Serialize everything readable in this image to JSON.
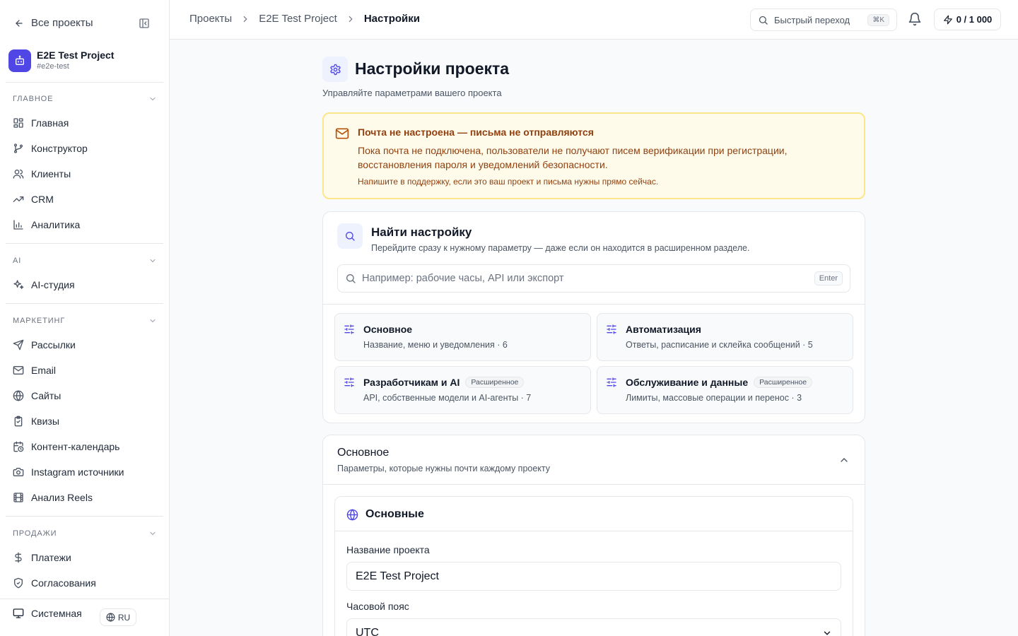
{
  "sidebar": {
    "back_label": "Все проекты",
    "project": {
      "name": "E2E Test Project",
      "slug": "#e2e-test"
    },
    "sections": [
      {
        "title": "ГЛАВНОЕ",
        "items": [
          "Главная",
          "Конструктор",
          "Клиенты",
          "CRM",
          "Аналитика"
        ]
      },
      {
        "title": "AI",
        "items": [
          "AI-студия"
        ]
      },
      {
        "title": "МАРКЕТИНГ",
        "items": [
          "Рассылки",
          "Email",
          "Сайты",
          "Квизы",
          "Контент-календарь",
          "Instagram источники",
          "Анализ Reels"
        ]
      },
      {
        "title": "ПРОДАЖИ",
        "items": [
          "Платежи",
          "Согласования"
        ]
      }
    ],
    "theme_label": "Системная",
    "language": "RU"
  },
  "topbar": {
    "breadcrumb": [
      "Проекты",
      "E2E Test Project",
      "Настройки"
    ],
    "quick_nav_label": "Быстрый переход",
    "quick_nav_shortcut": "⌘K",
    "credits": "0 / 1 000"
  },
  "page": {
    "title": "Настройки проекта",
    "subtitle": "Управляйте параметрами вашего проекта"
  },
  "alert": {
    "title": "Почта не настроена — письма не отправляются",
    "body": "Пока почта не подключена, пользователи не получают писем верификации при регистрации, восстановления пароля и уведомлений безопасности.",
    "note": "Напишите в поддержку, если это ваш проект и письма нужны прямо сейчас."
  },
  "find": {
    "title": "Найти настройку",
    "subtitle": "Перейдите сразу к нужному параметру — даже если он находится в расширенном разделе.",
    "placeholder": "Например: рабочие часы, API или экспорт",
    "enter_hint": "Enter",
    "categories": [
      {
        "title": "Основное",
        "desc": "Название, меню и уведомления · 6",
        "badge": ""
      },
      {
        "title": "Автоматизация",
        "desc": "Ответы, расписание и склейка сообщений · 5",
        "badge": ""
      },
      {
        "title": "Разработчикам и AI",
        "desc": "API, собственные модели и AI-агенты · 7",
        "badge": "Расширенное"
      },
      {
        "title": "Обслуживание и данные",
        "desc": "Лимиты, массовые операции и перенос · 3",
        "badge": "Расширенное"
      }
    ]
  },
  "basic_section": {
    "title": "Основное",
    "subtitle": "Параметры, которые нужны почти каждому проекту",
    "card_title": "Основные",
    "project_name_label": "Название проекта",
    "project_name_value": "E2E Test Project",
    "timezone_label": "Часовой пояс",
    "timezone_value": "UTC"
  },
  "colors": {
    "accent": "#4f46e5",
    "alert_bg": "#fffbeb",
    "alert_border": "#fde68a",
    "alert_text": "#92400e"
  }
}
